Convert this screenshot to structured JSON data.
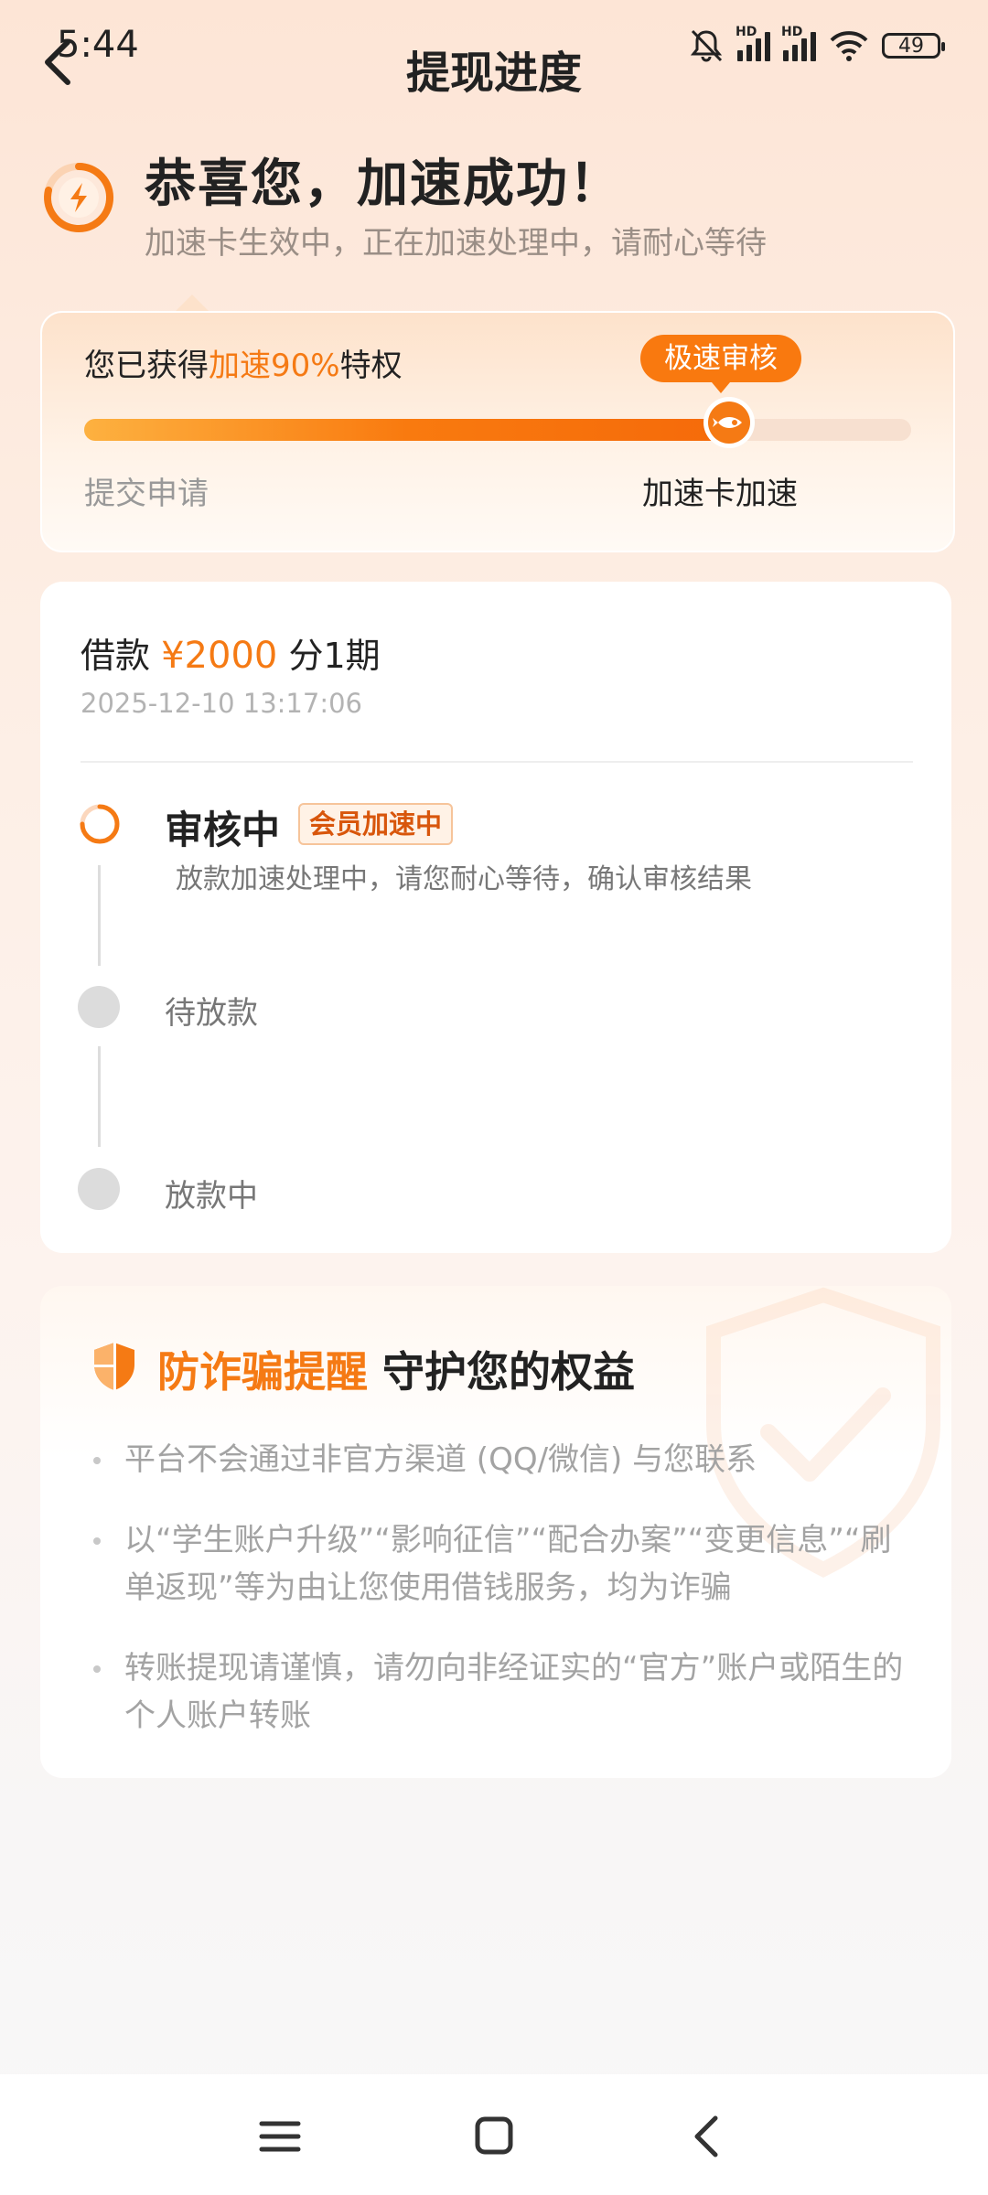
{
  "status_bar": {
    "time": "5:44",
    "battery": "49",
    "hd": "HD"
  },
  "nav": {
    "title": "提现进度"
  },
  "success": {
    "title": "恭喜您，加速成功！",
    "subtitle": "加速卡生效中，正在加速处理中，请耐心等待"
  },
  "progress": {
    "privilege_prefix": "您已获得",
    "privilege_highlight": "加速90%",
    "privilege_suffix": "特权",
    "badge": "极速审核",
    "start_label": "提交申请",
    "end_label": "加速卡加速",
    "fill_fraction": 0.78
  },
  "loan": {
    "label": "借款",
    "amount": "¥2000",
    "term": "分1期",
    "date": "2025-12-10 13:17:06",
    "steps": [
      {
        "title": "审核中",
        "badge": "会员加速中",
        "desc": "放款加速处理中，请您耐心等待，确认审核结果"
      },
      {
        "title": "待放款"
      },
      {
        "title": "放款中"
      }
    ]
  },
  "fraud": {
    "title_highlight": "防诈骗提醒",
    "title_rest": "守护您的权益",
    "tips": [
      "平台不会通过非官方渠道 (QQ/微信) 与您联系",
      "以“学生账户升级”“影响征信”“配合办案”“变更信息”“刷单返现”等为由让您使用借钱服务，均为诈骗",
      "转账提现请谨慎，请勿向非经证实的“官方”账户或陌生的个人账户转账"
    ]
  },
  "colors": {
    "accent": "#f57a14",
    "badge_bg": "#f9790f"
  }
}
